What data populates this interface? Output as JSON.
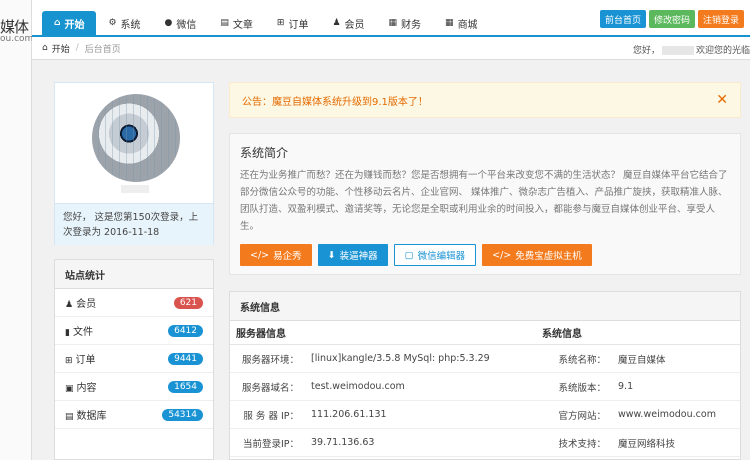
{
  "logo": {
    "text": "媒体",
    "sub": "ou.com"
  },
  "nav": [
    {
      "label": "开始",
      "icon": "home-icon",
      "glyph": "⌂",
      "active": true
    },
    {
      "label": "系统",
      "icon": "gear-icon",
      "glyph": "⚙"
    },
    {
      "label": "微信",
      "icon": "chat-icon",
      "glyph": "●"
    },
    {
      "label": "文章",
      "icon": "document-icon",
      "glyph": "▤"
    },
    {
      "label": "订单",
      "icon": "cart-icon",
      "glyph": "⊞"
    },
    {
      "label": "会员",
      "icon": "user-icon",
      "glyph": "♟"
    },
    {
      "label": "财务",
      "icon": "grid-icon",
      "glyph": "▦"
    },
    {
      "label": "商城",
      "icon": "table-icon",
      "glyph": "▦"
    }
  ],
  "top_buttons": {
    "front": "前台首页",
    "password": "修改密码",
    "logout": "注销登录"
  },
  "breadcrumb": {
    "home": "开始",
    "current": "后台首页"
  },
  "welcome": {
    "prefix": "您好，",
    "suffix": "欢迎您的光临"
  },
  "profile": {
    "message": "您好，    这是您第150次登录，上次登录为 2016-11-18"
  },
  "stats": {
    "title": "站点统计",
    "rows": [
      {
        "label": "会员",
        "icon": "user-icon",
        "glyph": "♟",
        "count": "621",
        "color": "#d9534f"
      },
      {
        "label": "文件",
        "icon": "file-icon",
        "glyph": "▮",
        "count": "6412",
        "color": "#1a93d4"
      },
      {
        "label": "订单",
        "icon": "cart-icon",
        "glyph": "⊞",
        "count": "9441",
        "color": "#1a93d4"
      },
      {
        "label": "内容",
        "icon": "content-icon",
        "glyph": "▣",
        "count": "1654",
        "color": "#1a93d4"
      },
      {
        "label": "数据库",
        "icon": "database-icon",
        "glyph": "▤",
        "count": "54314",
        "color": "#1a93d4"
      }
    ]
  },
  "notice": {
    "text": "公告：魔豆自媒体系统升级到9.1版本了！",
    "close": "✕"
  },
  "intro": {
    "title": "系统简介",
    "body": "还在为业务推广而愁？还在为赚钱而愁？您是否想拥有一个平台来改变您不满的生活状态？ 魔豆自媒体平台它结合了部分微信公众号的功能、个性移动云名片、企业官网、 媒体推广、微杂志广告植入、产品推广旋挟，获取精准人脉、团队打造、双盈利模式、邀请奖等，无论您是全职或利用业余的时间投入，都能参与魔豆自媒体创业平台、享受人生。",
    "buttons": [
      {
        "label": "易企秀",
        "style": "orange",
        "glyph": "</>"
      },
      {
        "label": "装逼神器",
        "style": "blue",
        "glyph": "⬇"
      },
      {
        "label": "微信编辑器",
        "style": "white",
        "glyph": "▢"
      },
      {
        "label": "免费宝虚拟主机",
        "style": "orange",
        "glyph": "</>"
      }
    ]
  },
  "sysinfo": {
    "title": "系统信息",
    "left_header": "服务器信息",
    "right_header": "系统信息",
    "rows": [
      {
        "k": "服务器环境：",
        "v": "[linux]kangle/3.5.8 MySql: php:5.3.29",
        "k2": "系统名称：",
        "v2": "魔豆自媒体"
      },
      {
        "k": "服务器域名：",
        "v": "test.weimodou.com",
        "k2": "系统版本：",
        "v2": "9.1"
      },
      {
        "k": "服 务 器 IP：",
        "v": "111.206.61.131",
        "k2": "官方网站：",
        "v2": "www.weimodou.com"
      },
      {
        "k": "当前登录IP：",
        "v": "39.71.136.63",
        "k2": "技术支持：",
        "v2": "魔豆网络科技"
      }
    ]
  }
}
